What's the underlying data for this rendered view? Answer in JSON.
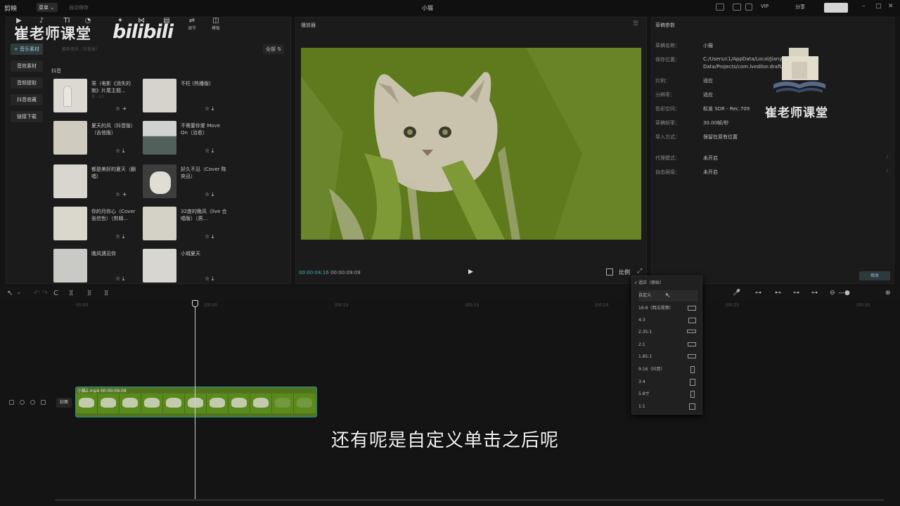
{
  "app": {
    "logo": "剪映",
    "menu": "菜单",
    "autosave": "自动保存",
    "title": "小猫",
    "vip": "VIP",
    "share": "分享",
    "window_min": "–",
    "window_max": "□",
    "window_close": "✕"
  },
  "toolbar": {
    "items": [
      {
        "symbol": "▶",
        "label": "媒体"
      },
      {
        "symbol": "♪",
        "label": "音频"
      },
      {
        "symbol": "TI",
        "label": "文本"
      },
      {
        "symbol": "◔",
        "label": "贴纸"
      },
      {
        "symbol": "✦",
        "label": "特效"
      },
      {
        "symbol": "⋈",
        "label": "转场"
      },
      {
        "symbol": "▤",
        "label": "滤镜"
      },
      {
        "symbol": "⇌",
        "label": "调节"
      },
      {
        "symbol": "◫",
        "label": "模板"
      }
    ]
  },
  "watermark": {
    "text": "崔老师课堂",
    "bili": "bilibili"
  },
  "library": {
    "nav": [
      {
        "label": "+ 音乐素材"
      },
      {
        "label": "音效素材"
      },
      {
        "label": "音频提取"
      },
      {
        "label": "抖音收藏"
      },
      {
        "label": "链接下载"
      }
    ],
    "sort": "全部  ⇅",
    "section_tag": "推荐音乐（未登录）",
    "section_title": "抖音",
    "items": [
      {
        "name": "笼（电影《消失的她》片尾主题...",
        "sub": "张 · 3:1",
        "actions": "☆  +"
      },
      {
        "name": "不枉 (热播版)",
        "sub": "",
        "actions": "☆  ⤓"
      },
      {
        "name": "夏天的风（抖音版）（吉他版）",
        "sub": "",
        "actions": "☆  ⤓"
      },
      {
        "name": "不需要你爱 Move On（治愈）",
        "sub": "",
        "actions": "☆  ⤓"
      },
      {
        "name": "都是美好的夏天（翻唱）",
        "sub": "",
        "actions": "☆  +"
      },
      {
        "name": "好久不见（Cover 陈奕迅）",
        "sub": "",
        "actions": "☆  ⤓"
      },
      {
        "name": "你的月你心（Cover 张信哲）（剪辑...",
        "sub": "",
        "actions": "☆  ⤓"
      },
      {
        "name": "32度的晚风（live 合唱版）（男...",
        "sub": "",
        "actions": "☆  ⤓"
      },
      {
        "name": "晚风遇见你",
        "sub": "",
        "actions": "☆  ⤓"
      },
      {
        "name": "小城夏天",
        "sub": "",
        "actions": "☆  ⤓"
      }
    ]
  },
  "player": {
    "title": "播放器",
    "menu_icon": "☰",
    "time_current": "00:00:04:16",
    "time_total": "00:00:09:09",
    "play": "▶",
    "ratio_button": "比例",
    "fullscreen": "⤢"
  },
  "props": {
    "title": "草稿参数",
    "rows": [
      {
        "label": "草稿名称：",
        "value": "小猫",
        "hint": ""
      },
      {
        "label": "保存位置：",
        "value": "C:/Users/c1/AppData/Local/JianyingPro/User Data/Projects/com.lveditor.draft/小猫",
        "hint": ""
      },
      {
        "label": "比例：",
        "value": "适应",
        "hint": ""
      },
      {
        "label": "分辨率：",
        "value": "适应",
        "hint": ""
      },
      {
        "label": "色彩空间：",
        "value": "标准 SDR - Rec.709",
        "hint": ""
      },
      {
        "label": "草稿帧率：",
        "value": "30.00帧/秒",
        "hint": ""
      },
      {
        "label": "导入方式：",
        "value": "保留在原有位置",
        "hint": ""
      },
      {
        "label": "代理模式：",
        "value": "未开启",
        "hint": "?"
      },
      {
        "label": "自由层级：",
        "value": "未开启",
        "hint": "?"
      }
    ],
    "logo_text": "崔老师课堂",
    "modify_button": "修改"
  },
  "timeline": {
    "tools_left": [
      "↖",
      "⌄",
      "↶",
      "↷",
      "C",
      "][",
      "][",
      "]["
    ],
    "tools_right": [
      "🎤",
      "⊶",
      "⊷",
      "⊶",
      "⊶",
      "⊷",
      "⊖",
      "—●",
      "⊕"
    ],
    "ticks": [
      "00:00",
      "|00:05",
      "|00:10",
      "|00:15",
      "|00:20",
      "|00:25",
      "|00:30"
    ],
    "clip_label": "小猫2.mp4   00:00:09:09",
    "cover_label": "封面"
  },
  "ratio_menu": {
    "options": [
      {
        "label": "适应（原始）",
        "checked": true
      },
      {
        "label": "自定义",
        "checked": false
      },
      {
        "label": "16:9（西瓜视频）",
        "checked": false
      },
      {
        "label": "4:3",
        "checked": false
      },
      {
        "label": "2.35:1",
        "checked": false
      },
      {
        "label": "2:1",
        "checked": false
      },
      {
        "label": "1.85:1",
        "checked": false
      },
      {
        "label": "9:16（抖音）",
        "checked": false
      },
      {
        "label": "3:4",
        "checked": false
      },
      {
        "label": "5.8寸",
        "checked": false
      },
      {
        "label": "1:1",
        "checked": false
      }
    ]
  },
  "subtitle": "还有呢是自定义单击之后呢",
  "colors": {
    "video_green": "#5e7a1c",
    "accent_cyan": "#4ea8b8",
    "background": "#141414"
  }
}
